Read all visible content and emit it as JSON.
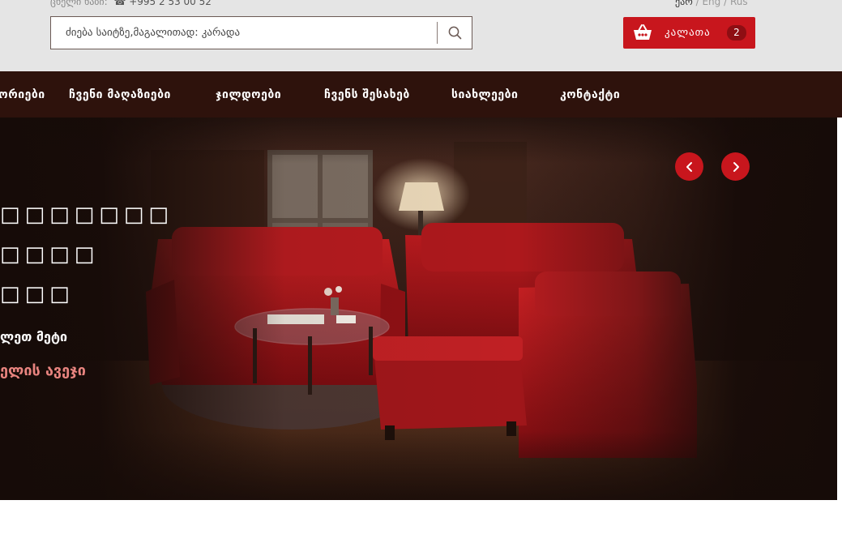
{
  "header": {
    "hotline_label": "ცხელი ხაზი:",
    "phone": "☎ +995 2 53 00 52",
    "lang_active": "ქარ",
    "lang_separator_1": " / ",
    "lang_eng": "Eng",
    "lang_separator_2": " / ",
    "lang_rus": "Rus"
  },
  "search": {
    "placeholder": "ძიება საიტზე,მაგალითად: კარადა"
  },
  "cart": {
    "label": "კალათა",
    "count": "2"
  },
  "nav": {
    "items": [
      {
        "label": "კატეგორიები"
      },
      {
        "label": "ჩვენი მაღაზიები"
      },
      {
        "label": "ჯილდოები"
      },
      {
        "label": "ჩვენს შესახებ"
      },
      {
        "label": "სიახლეები"
      },
      {
        "label": "კონტაქტი"
      }
    ]
  },
  "hero": {
    "line1": "□□□□□□□",
    "line2": "□□□□",
    "line3": "□□□",
    "more": "ლეთ მეტი",
    "link": "ელის ავეჯი"
  },
  "colors": {
    "accent": "#c8161d",
    "nav_bg": "#2e120c",
    "header_bg": "#e5e5e5",
    "link": "#e8847f"
  },
  "icons": {
    "search": "search-icon",
    "cart": "basket-icon",
    "prev": "chevron-left-icon",
    "next": "chevron-right-icon"
  }
}
